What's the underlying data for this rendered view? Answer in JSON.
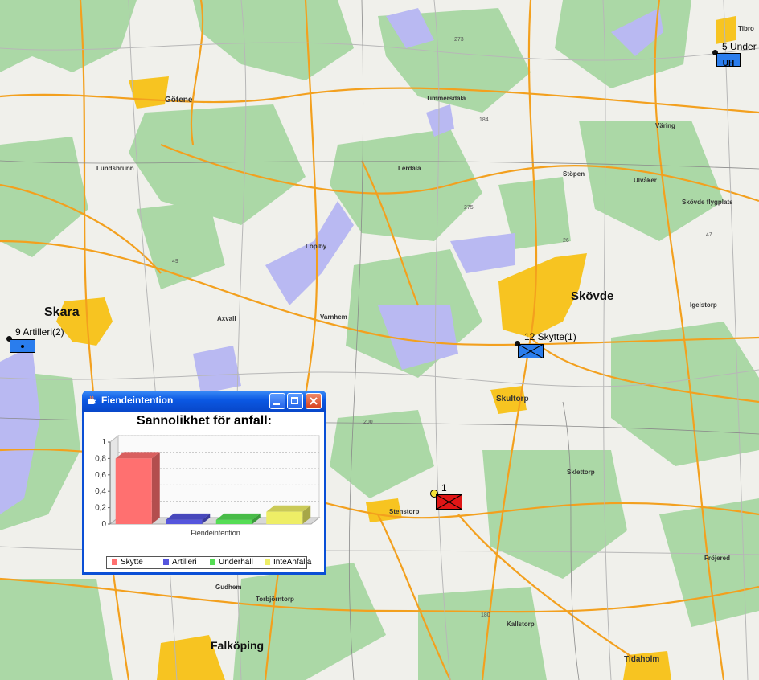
{
  "places": {
    "skara": "Skara",
    "skovde": "Skövde",
    "falkoping": "Falköping",
    "gotene": "Götene",
    "lundsbrunn": "Lundsbrunn",
    "lerdala": "Lerdala",
    "timmersdala": "Timmersdala",
    "lopby": "Loplby",
    "axvall": "Axvall",
    "varnhem": "Varnhem",
    "skultorp": "Skultorp",
    "stenstorp": "Stenstorp",
    "gudhem": "Gudhem",
    "torbjorntorp": "Torbjörntorp",
    "tidaholm": "Tidaholm",
    "ulvakar": "Ulvåker",
    "stopen": "Stöpen",
    "valing": "Väring",
    "skovde_flygplats": "Skövde flygplats",
    "igelstorp": "Igelstorp",
    "frojered": "Fröjered",
    "kallstorp": "Kallstorp",
    "sklettorp": "Sklettorp",
    "tibro": "Tibro"
  },
  "roads": [
    "273",
    "275",
    "200",
    "49",
    "26",
    "47",
    "184",
    "180"
  ],
  "units": [
    {
      "label": "9 Artilleri(2)",
      "symbol": "artillery-symbol",
      "color": "#2277ee"
    },
    {
      "label": "12 Skytte(1)",
      "symbol": "infantry-symbol",
      "color": "#2277ee"
    },
    {
      "label": "5 Under",
      "symbol": "support-symbol",
      "code": "UH",
      "color": "#2277ee"
    },
    {
      "label": "1",
      "symbol": "enemy-infantry-symbol",
      "color": "#dd1111"
    }
  ],
  "window": {
    "title": "Fiendeintention"
  },
  "chart_data": {
    "type": "bar",
    "title": "Sannolikhet för anfall:",
    "xlabel": "Fiendeintention",
    "ylabel": "",
    "ylim": [
      0,
      1
    ],
    "yticks": [
      "0",
      "0,2",
      "0,4",
      "0,6",
      "0,8",
      "1"
    ],
    "categories": [
      "Skytte",
      "Artilleri",
      "Underhall",
      "InteAnfalla"
    ],
    "values": [
      0.8,
      0.05,
      0.05,
      0.15
    ],
    "colors": [
      "#ff7070",
      "#5555dd",
      "#55dd55",
      "#eeee66"
    ],
    "legend": "bottom",
    "grid": true
  }
}
